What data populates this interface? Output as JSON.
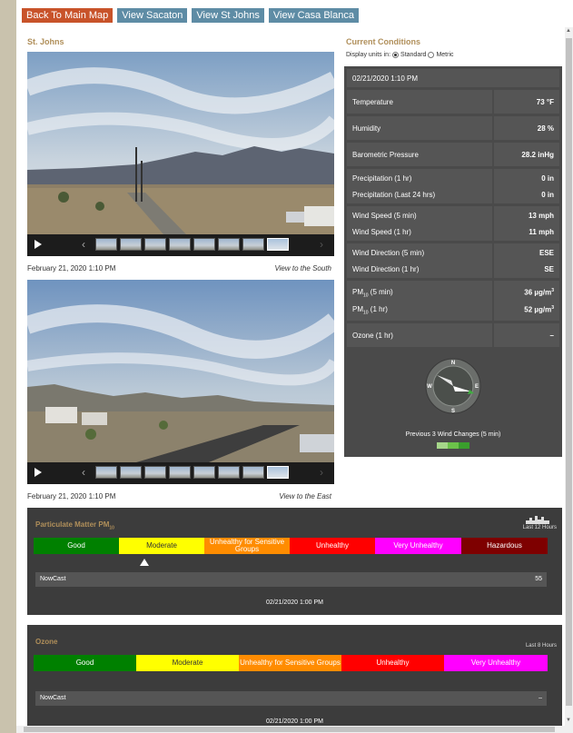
{
  "nav": {
    "main_map": "Back To Main Map",
    "sacaton": "View Sacaton",
    "st_johns": "View St Johns",
    "casa_blanca": "View Casa Blanca"
  },
  "camera": {
    "site_title": "St. Johns",
    "cam1": {
      "date": "February 21, 2020 1:10 PM",
      "view": "View to the South"
    },
    "cam2": {
      "date": "February 21, 2020 1:10 PM",
      "view": "View to the East"
    },
    "prev_glyph": "‹",
    "next_glyph": "›"
  },
  "conditions": {
    "title": "Current Conditions",
    "units_label": "Display units in:",
    "unit_standard": "Standard",
    "unit_metric": "Metric",
    "unit_selected": "Standard",
    "timestamp": "02/21/2020 1:10 PM",
    "temperature": {
      "label": "Temperature",
      "value": "73 °F"
    },
    "humidity": {
      "label": "Humidity",
      "value": "28 %"
    },
    "pressure": {
      "label": "Barometric Pressure",
      "value": "28.2 inHg"
    },
    "precip_1hr": {
      "label": "Precipitation (1 hr)",
      "value": "0 in"
    },
    "precip_24hr": {
      "label": "Precipitation (Last 24 hrs)",
      "value": "0 in"
    },
    "wind_speed_5min": {
      "label": "Wind Speed (5 min)",
      "value": "13 mph"
    },
    "wind_speed_1hr": {
      "label": "Wind Speed (1 hr)",
      "value": "11 mph"
    },
    "wind_dir_5min": {
      "label": "Wind Direction (5 min)",
      "value": "ESE"
    },
    "wind_dir_1hr": {
      "label": "Wind Direction (1 hr)",
      "value": "SE"
    },
    "pm10_5min": {
      "label_prefix": "PM",
      "label_sub": "10",
      "label_suffix": " (5 min)",
      "value_num": "36 µg/m",
      "value_sup": "3"
    },
    "pm10_1hr": {
      "label_prefix": "PM",
      "label_sub": "10",
      "label_suffix": " (1 hr)",
      "value_num": "52 µg/m",
      "value_sup": "3"
    },
    "ozone_1hr": {
      "label": "Ozone (1 hr)",
      "value": "–"
    },
    "compass": {
      "n": "N",
      "e": "E",
      "s": "S",
      "w": "W"
    },
    "wind_changes_label": "Previous 3 Wind Changes (5 min)",
    "wind_change_colors": [
      "#a6d78a",
      "#6cc24a",
      "#3a9e2c"
    ]
  },
  "pm_panel": {
    "title_prefix": "Particulate Matter PM",
    "title_sub": "10",
    "note": "Last 12 Hours",
    "categories": [
      {
        "label": "Good",
        "color": "#008000",
        "text_color": "#ffffff"
      },
      {
        "label": "Moderate",
        "color": "#ffff00",
        "text_color": "#333333"
      },
      {
        "label": "Unhealthy for Sensitive Groups",
        "color": "#ff8c00",
        "text_color": "#ffffff"
      },
      {
        "label": "Unhealthy",
        "color": "#ff0000",
        "text_color": "#ffffff"
      },
      {
        "label": "Very Unhealthy",
        "color": "#ff00ff",
        "text_color": "#ffffff"
      },
      {
        "label": "Hazardous",
        "color": "#7e0000",
        "text_color": "#ffffff"
      }
    ],
    "nowcast_label": "NowCast",
    "nowcast_value": "55",
    "time": "02/21/2020 1:00 PM"
  },
  "ozone_panel": {
    "title": "Ozone",
    "note": "Last 8 Hours",
    "categories": [
      {
        "label": "Good",
        "color": "#008000",
        "text_color": "#ffffff"
      },
      {
        "label": "Moderate",
        "color": "#ffff00",
        "text_color": "#333333"
      },
      {
        "label": "Unhealthy for Sensitive Groups",
        "color": "#ff8c00",
        "text_color": "#ffffff"
      },
      {
        "label": "Unhealthy",
        "color": "#ff0000",
        "text_color": "#ffffff"
      },
      {
        "label": "Very Unhealthy",
        "color": "#ff00ff",
        "text_color": "#ffffff"
      }
    ],
    "nowcast_label": "NowCast",
    "nowcast_value": "–",
    "time": "02/21/2020 1:00 PM"
  }
}
